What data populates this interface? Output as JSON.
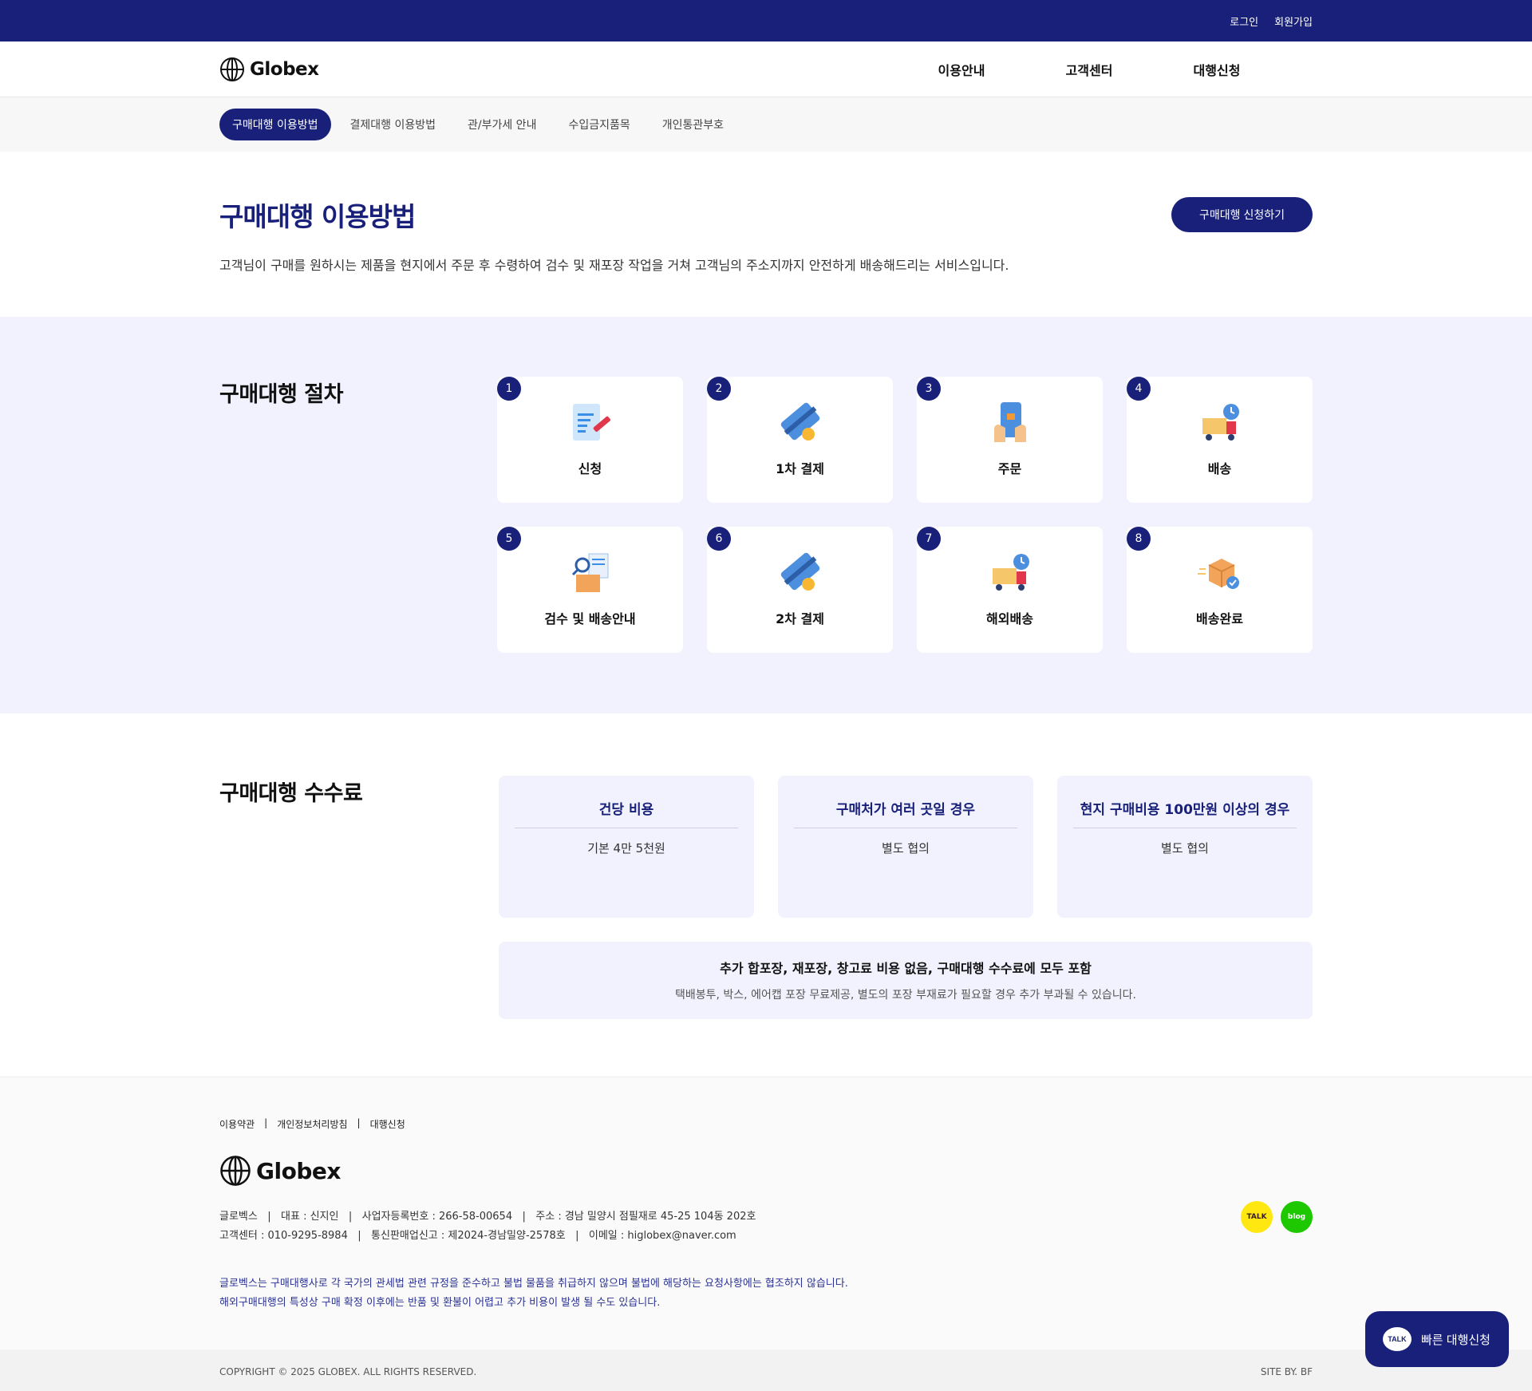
{
  "topbar": {
    "login": "로그인",
    "signup": "회원가입"
  },
  "header": {
    "logo": "Globex",
    "nav": [
      "이용안내",
      "고객센터",
      "대행신청"
    ]
  },
  "subnav": [
    "구매대행 이용방법",
    "결제대행 이용방법",
    "관/부가세 안내",
    "수입금지품목",
    "개인통관부호"
  ],
  "hero": {
    "title": "구매대행 이용방법",
    "desc": "고객님이 구매를 원하시는 제품을 현지에서 주문 후 수령하여 검수 및 재포장 작업을 거쳐 고객님의 주소지까지 안전하게 배송해드리는 서비스입니다.",
    "button": "구매대행 신청하기"
  },
  "process": {
    "title": "구매대행 절차",
    "steps": [
      {
        "num": "1",
        "label": "신청",
        "icon": "document-pen-icon"
      },
      {
        "num": "2",
        "label": "1차 결제",
        "icon": "credit-card-icon"
      },
      {
        "num": "3",
        "label": "주문",
        "icon": "phone-order-icon"
      },
      {
        "num": "4",
        "label": "배송",
        "icon": "delivery-truck-icon"
      },
      {
        "num": "5",
        "label": "검수 및 배송안내",
        "icon": "inspection-box-icon"
      },
      {
        "num": "6",
        "label": "2차 결제",
        "icon": "credit-card-icon"
      },
      {
        "num": "7",
        "label": "해외배송",
        "icon": "overseas-truck-icon"
      },
      {
        "num": "8",
        "label": "배송완료",
        "icon": "delivered-box-icon"
      }
    ]
  },
  "fees": {
    "title": "구매대행 수수료",
    "cards": [
      {
        "title": "건당 비용",
        "value": "기본 4만 5천원"
      },
      {
        "title": "구매처가 여러 곳일 경우",
        "value": "별도 협의"
      },
      {
        "title": "현지 구매비용 100만원 이상의 경우",
        "value": "별도 협의"
      }
    ],
    "note_title": "추가 합포장, 재포장, 창고료 비용 없음, 구매대행 수수료에 모두 포함",
    "note_desc": "택배봉투, 박스, 에어캡 포장 무료제공, 별도의 포장 부재료가 필요할 경우 추가 부과될 수 있습니다."
  },
  "footer": {
    "links": [
      "이용약관",
      "개인정보처리방침",
      "대행신청"
    ],
    "link_sep": "|",
    "logo": "Globex",
    "info_line1": "글로벡스   |   대표 : 신지인   |   사업자등록번호 : 266-58-00654   |   주소 : 경남 밀양시 점필재로 45-25 104동 202호",
    "info_line2": "고객센터 : 010-9295-8984   |   통신판매업신고 : 제2024-경남밀양-2578호   |   이메일 : higlobex@naver.com",
    "notice_line1": "글로벡스는 구매대행사로 각 국가의 관세법 관련 규정을 준수하고 불법 물품을 취급하지 않으며 불법에 해당하는 요청사항에는 협조하지 않습니다.",
    "notice_line2": "해외구매대행의 특성상 구매 확정 이후에는 반품 및 환불이 어렵고 추가 비용이 발생 될 수도 있습니다.",
    "sns_talk": "TALK",
    "sns_blog": "blog",
    "copyright": "COPYRIGHT © 2025 GLOBEX. ALL RIGHTS RESERVED.",
    "siteby": "SITE BY. BF"
  },
  "float_button": {
    "badge": "TALK",
    "label": "빠른 대행신청"
  },
  "colors": {
    "primary": "#18207a",
    "light_bg": "#f1f2fd",
    "kakao": "#ffe812",
    "blog": "#1ec800"
  }
}
